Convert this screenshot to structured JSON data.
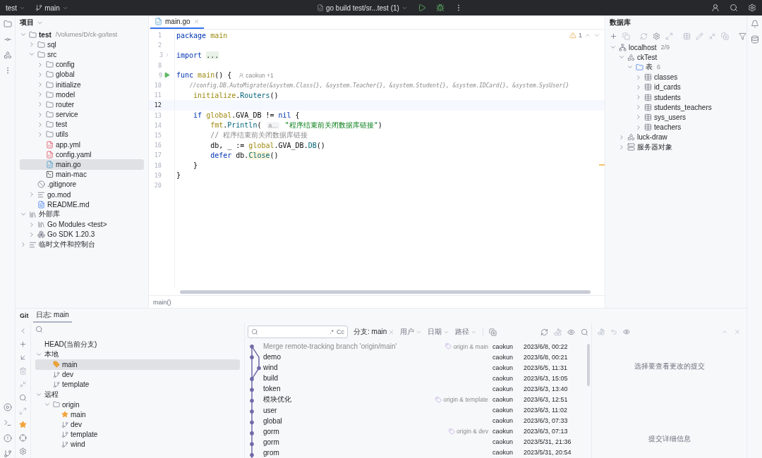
{
  "topbar": {
    "project": "test",
    "branch": "main",
    "run_config": "go build test/sr...test (1)"
  },
  "project_panel": {
    "title": "项目",
    "tree": [
      {
        "label": "test",
        "path": "/Volumes/D/ck-go/test",
        "kind": "folder",
        "expanded": true,
        "selected": false,
        "children": [
          {
            "label": "sql",
            "kind": "folder",
            "expanded": false,
            "selected": false
          },
          {
            "label": "src",
            "kind": "folder",
            "expanded": true,
            "selected": false,
            "children": [
              {
                "label": "config",
                "kind": "folder",
                "expanded": false,
                "selected": false
              },
              {
                "label": "global",
                "kind": "folder",
                "expanded": false,
                "selected": false
              },
              {
                "label": "initialize",
                "kind": "folder",
                "expanded": false,
                "selected": false
              },
              {
                "label": "model",
                "kind": "folder",
                "expanded": false,
                "selected": false
              },
              {
                "label": "router",
                "kind": "folder",
                "expanded": false,
                "selected": false
              },
              {
                "label": "service",
                "kind": "folder",
                "expanded": false,
                "selected": false
              },
              {
                "label": "test",
                "kind": "folder",
                "expanded": false,
                "selected": false
              },
              {
                "label": "utils",
                "kind": "folder",
                "expanded": false,
                "selected": false
              },
              {
                "label": "app.yml",
                "kind": "yaml",
                "selected": false
              },
              {
                "label": "config.yaml",
                "kind": "yaml",
                "selected": false
              },
              {
                "label": "main.go",
                "kind": "go",
                "selected": true
              },
              {
                "label": "main-mac",
                "kind": "binary",
                "selected": false
              }
            ]
          },
          {
            "label": ".gitignore",
            "kind": "ignore",
            "selected": false
          },
          {
            "label": "go.mod",
            "kind": "mod",
            "expanded": false,
            "selected": false
          },
          {
            "label": "README.md",
            "kind": "md",
            "selected": false
          }
        ]
      },
      {
        "label": "外部库",
        "kind": "library",
        "expanded": true,
        "selected": false,
        "children": [
          {
            "label": "Go Modules <test>",
            "kind": "library",
            "expanded": false,
            "selected": false
          },
          {
            "label": "Go SDK 1.20.3",
            "kind": "sdk",
            "expanded": false,
            "selected": false
          }
        ]
      },
      {
        "label": "临时文件和控制台",
        "kind": "scratch",
        "expanded": false,
        "selected": false
      }
    ]
  },
  "editor": {
    "tabs": [
      {
        "label": "main.go",
        "selected": true
      }
    ],
    "warnings": "1",
    "breadcrumb": "main()",
    "lines": [
      {
        "n": "1",
        "current": false,
        "tokens": [
          {
            "t": "package ",
            "kind": "kw"
          },
          {
            "t": "main",
            "kind": "pkg"
          }
        ]
      },
      {
        "n": "2",
        "current": false
      },
      {
        "n": "3",
        "current": false,
        "gutter": {
          "kind": "fold"
        },
        "tokens": [
          {
            "t": "import ",
            "kind": "kw"
          },
          {
            "t": "...",
            "kind": "folded"
          }
        ]
      },
      {
        "n": "8",
        "current": false
      },
      {
        "n": "9",
        "current": false,
        "gutter": {
          "kind": "run"
        },
        "tokens": [
          {
            "t": "func ",
            "kind": "kw"
          },
          {
            "t": "main",
            "kind": "decl"
          },
          {
            "t": "() {",
            "kind": "plain"
          },
          {
            "t": "caokun +1",
            "kind": "author"
          }
        ]
      },
      {
        "n": "10",
        "current": false,
        "tokens": [
          {
            "t": "    //config.DB.AutoMigrate(&system.Class{}, &system.Teacher{}, &system.Student{}, &system.IDCard{}, &system.SysUser{}",
            "kind": "comment"
          }
        ]
      },
      {
        "n": "11",
        "current": false,
        "tokens": [
          {
            "t": "    initialize",
            "kind": "pkg"
          },
          {
            "t": ".",
            "kind": "plain"
          },
          {
            "t": "Routers",
            "kind": "call"
          },
          {
            "t": "()",
            "kind": "plain"
          }
        ]
      },
      {
        "n": "12",
        "current": true
      },
      {
        "n": "13",
        "current": false,
        "tokens": [
          {
            "t": "    if ",
            "kind": "kw"
          },
          {
            "t": "global",
            "kind": "pkg"
          },
          {
            "t": ".GVA_DB != ",
            "kind": "plain"
          },
          {
            "t": "nil",
            "kind": "kw"
          },
          {
            "t": " {",
            "kind": "plain"
          }
        ]
      },
      {
        "n": "14",
        "current": false,
        "tokens": [
          {
            "t": "        fmt",
            "kind": "pkg"
          },
          {
            "t": ".",
            "kind": "plain"
          },
          {
            "t": "Println",
            "kind": "call"
          },
          {
            "t": "( ",
            "kind": "plain"
          },
          {
            "t": "a…",
            "kind": "hint"
          },
          {
            "t": " \"程序结束前关闭数据库链接\"",
            "kind": "string"
          },
          {
            "t": ")",
            "kind": "plain"
          }
        ]
      },
      {
        "n": "15",
        "current": false,
        "tokens": [
          {
            "t": "        // 程序结束前关闭数据库链接",
            "kind": "comment_plain"
          }
        ]
      },
      {
        "n": "16",
        "current": false,
        "tokens": [
          {
            "t": "        db, _ := ",
            "kind": "plain"
          },
          {
            "t": "global",
            "kind": "pkg"
          },
          {
            "t": ".GVA_DB.",
            "kind": "plain"
          },
          {
            "t": "DB",
            "kind": "call"
          },
          {
            "t": "()",
            "kind": "plain"
          }
        ]
      },
      {
        "n": "17",
        "current": false,
        "tokens": [
          {
            "t": "        defer",
            "kind": "kw"
          },
          {
            "t": " db.",
            "kind": "plain"
          },
          {
            "t": "Close",
            "kind": "marked"
          },
          {
            "t": "()",
            "kind": "plain"
          }
        ]
      },
      {
        "n": "18",
        "current": false,
        "tokens": [
          {
            "t": "    }",
            "kind": "plain"
          }
        ]
      },
      {
        "n": "19",
        "current": false,
        "tokens": [
          {
            "t": "}",
            "kind": "plain"
          }
        ]
      },
      {
        "n": "20",
        "current": false
      }
    ]
  },
  "database_panel": {
    "title": "数据库",
    "tree": [
      {
        "label": "localhost",
        "count": "2/9",
        "kind": "host",
        "expanded": true,
        "children": [
          {
            "label": "ckTest",
            "kind": "schema",
            "expanded": true,
            "children": [
              {
                "label": "表",
                "count": "6",
                "kind": "folder",
                "expanded": true,
                "children": [
                  {
                    "label": "classes",
                    "kind": "table",
                    "expanded": false
                  },
                  {
                    "label": "id_cards",
                    "kind": "table",
                    "expanded": false
                  },
                  {
                    "label": "students",
                    "kind": "table",
                    "expanded": false
                  },
                  {
                    "label": "students_teachers",
                    "kind": "table",
                    "expanded": false
                  },
                  {
                    "label": "sys_users",
                    "kind": "table",
                    "expanded": false
                  },
                  {
                    "label": "teachers",
                    "kind": "table",
                    "expanded": false
                  }
                ]
              }
            ]
          },
          {
            "label": "luck-draw",
            "kind": "schema",
            "expanded": false
          },
          {
            "label": "服务器对象",
            "kind": "server",
            "expanded": false
          }
        ]
      }
    ]
  },
  "git_panel": {
    "title": "Git",
    "tabs": [
      {
        "label": "日志: main",
        "selected": true
      }
    ],
    "branches": [
      {
        "label": "HEAD(当前分支)",
        "selected": false
      },
      {
        "label": "本地",
        "expanded": true,
        "selected": false,
        "children": [
          {
            "label": "main",
            "kind": "current",
            "selected": true
          },
          {
            "label": "dev",
            "kind": "branch",
            "selected": false
          },
          {
            "label": "template",
            "kind": "branch",
            "selected": false
          }
        ]
      },
      {
        "label": "远程",
        "expanded": true,
        "selected": false,
        "children": [
          {
            "label": "origin",
            "kind": "remote",
            "expanded": true,
            "selected": false,
            "children": [
              {
                "label": "main",
                "kind": "favorite",
                "selected": false
              },
              {
                "label": "dev",
                "kind": "branch",
                "selected": false
              },
              {
                "label": "template",
                "kind": "branch",
                "selected": false
              },
              {
                "label": "wind",
                "kind": "branch",
                "selected": false
              }
            ]
          }
        ]
      }
    ],
    "log_toolbar": {
      "regex": ".*",
      "case": "Cc",
      "branch_filter": "分支: main",
      "filters": [
        "用户",
        "日期",
        "路径"
      ]
    },
    "commits": [
      {
        "subject": "Merge remote-tracking branch 'origin/main'",
        "muted": true,
        "refs": "origin & main",
        "author": "caokun",
        "date": "2023/6/8, 00:22"
      },
      {
        "subject": "demo",
        "muted": false,
        "author": "caokun",
        "date": "2023/6/8, 00:21"
      },
      {
        "subject": "wind",
        "muted": false,
        "author": "caokun",
        "date": "2023/6/5, 11:31"
      },
      {
        "subject": "build",
        "muted": false,
        "author": "caokun",
        "date": "2023/6/3, 15:05"
      },
      {
        "subject": "token",
        "muted": false,
        "author": "caokun",
        "date": "2023/6/3, 13:40"
      },
      {
        "subject": "模块优化",
        "muted": false,
        "refs": "origin & template",
        "author": "caokun",
        "date": "2023/6/3, 12:51"
      },
      {
        "subject": "user",
        "muted": false,
        "author": "caokun",
        "date": "2023/6/3, 11:02"
      },
      {
        "subject": "global",
        "muted": false,
        "author": "caokun",
        "date": "2023/6/3, 07:33"
      },
      {
        "subject": "gorm",
        "muted": false,
        "refs": "origin & dev",
        "author": "caokun",
        "date": "2023/6/3, 07:13"
      },
      {
        "subject": "gorm",
        "muted": false,
        "author": "caokun",
        "date": "2023/5/31, 21:36"
      },
      {
        "subject": "grom",
        "muted": false,
        "author": "caokun",
        "date": "2023/5/31, 20:54"
      }
    ],
    "details": {
      "empty_text": "选择要查看更改的提交",
      "footer": "提交详细信息"
    }
  }
}
